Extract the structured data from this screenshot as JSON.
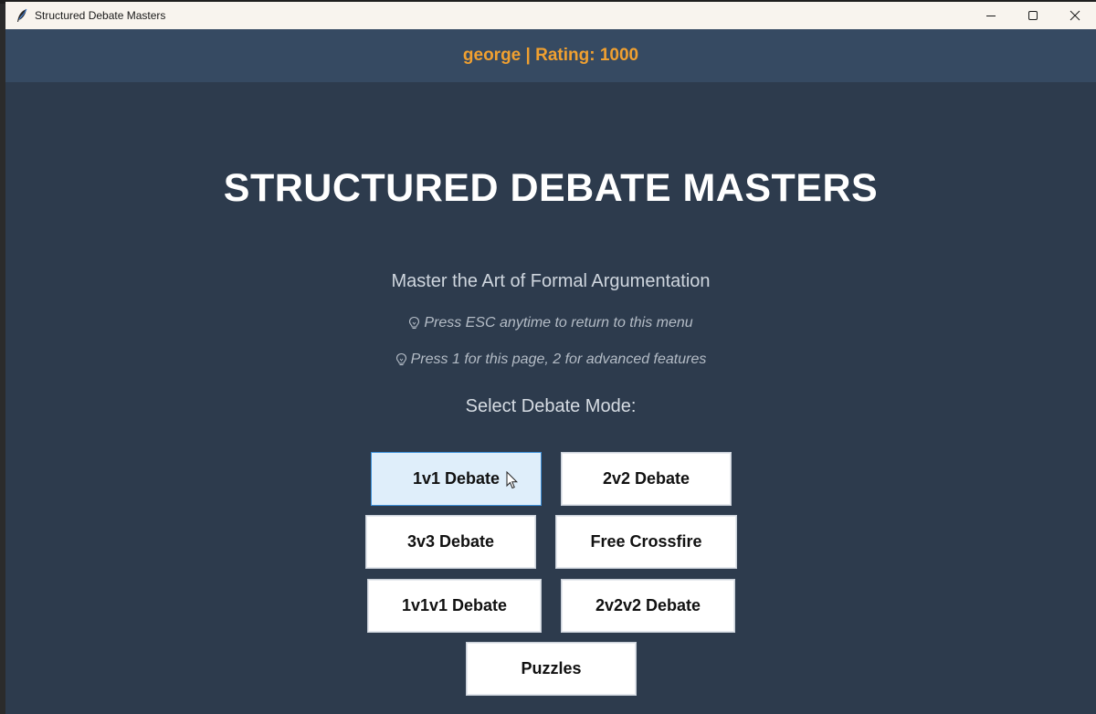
{
  "window": {
    "title": "Structured Debate Masters"
  },
  "user": {
    "info": "george | Rating: 1000"
  },
  "main": {
    "title": "STRUCTURED DEBATE MASTERS",
    "subtitle": "Master the Art of Formal Argumentation",
    "hints": [
      "Press ESC anytime to return to this menu",
      "Press 1 for this page, 2 for advanced features"
    ],
    "mode_label": "Select Debate Mode:"
  },
  "modes": [
    {
      "label": "1v1 Debate",
      "active": true
    },
    {
      "label": "2v2 Debate"
    },
    {
      "label": "3v3 Debate"
    },
    {
      "label": "Free Crossfire"
    },
    {
      "label": "1v1v1 Debate"
    },
    {
      "label": "2v2v2 Debate"
    },
    {
      "label": "Puzzles"
    }
  ],
  "colors": {
    "background": "#2d3b4d",
    "userbar": "#364a62",
    "accent": "#f0a030",
    "active_button": "#dfeefa",
    "active_border": "#3c8fd8"
  },
  "icons": {
    "app": "feather-icon",
    "hint": "lightbulb-icon",
    "minimize": "minimize-icon",
    "maximize": "maximize-icon",
    "close": "close-icon"
  }
}
